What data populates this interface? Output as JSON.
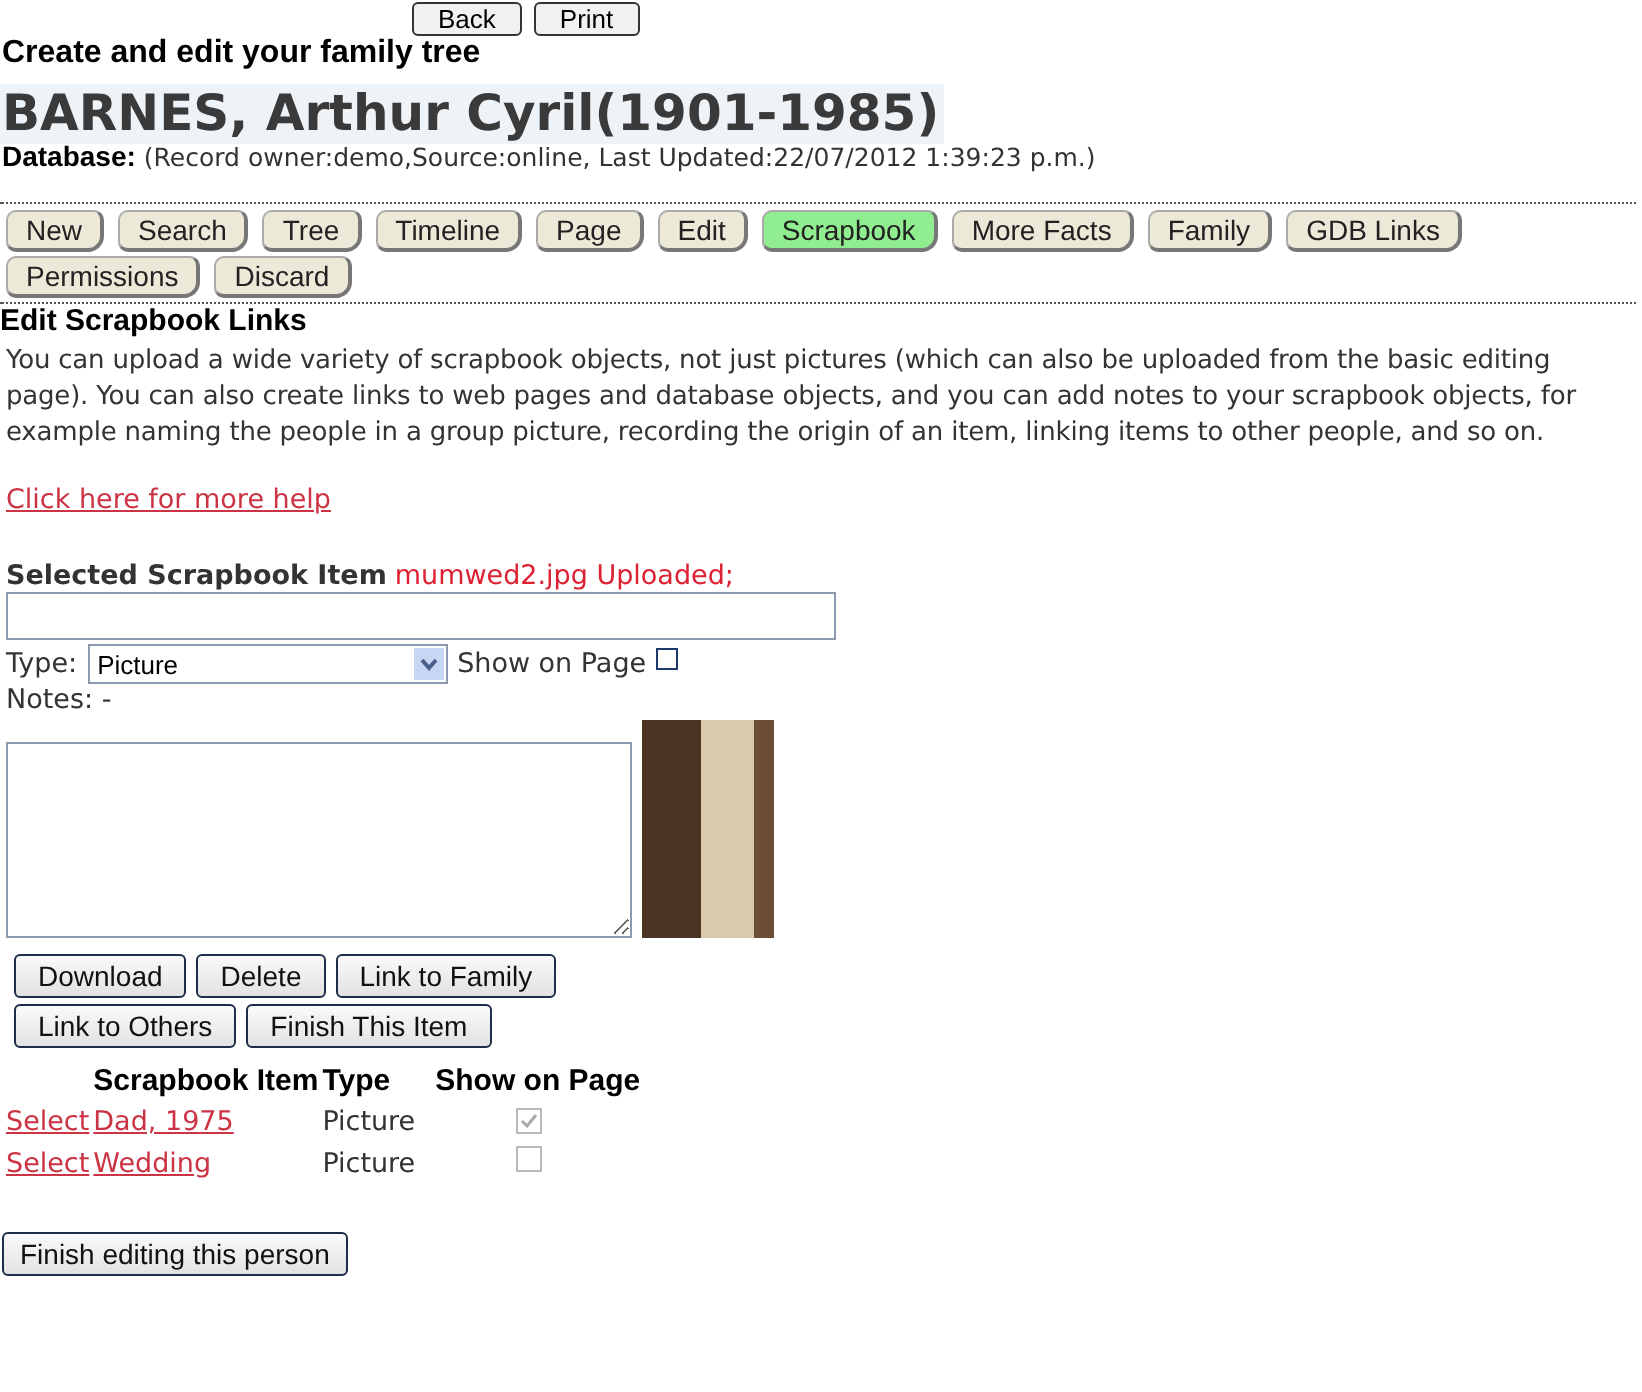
{
  "top_buttons": [
    "Back",
    "Print"
  ],
  "page_heading": "Create and edit your family tree",
  "person": {
    "name": "BARNES, Arthur Cyril(1901-1985)",
    "database_label": "Database:",
    "database_info": "(Record owner:demo,Source:online, Last Updated:22/07/2012 1:39:23 p.m.)"
  },
  "tabs": [
    {
      "label": "New",
      "selected": false
    },
    {
      "label": "Search",
      "selected": false
    },
    {
      "label": "Tree",
      "selected": false
    },
    {
      "label": "Timeline",
      "selected": false
    },
    {
      "label": "Page",
      "selected": false
    },
    {
      "label": "Edit",
      "selected": false
    },
    {
      "label": "Scrapbook",
      "selected": true
    },
    {
      "label": "More Facts",
      "selected": false
    },
    {
      "label": "Family",
      "selected": false
    },
    {
      "label": "GDB Links",
      "selected": false
    },
    {
      "label": "Permissions",
      "selected": false
    },
    {
      "label": "Discard",
      "selected": false
    }
  ],
  "section_title": "Edit Scrapbook Links",
  "intro": "You can upload a wide variety of scrapbook objects, not just pictures (which can also be uploaded from the basic editing page). You can also create links to web pages and database objects, and you can add notes to your scrapbook objects, for example naming the people in a group picture, recording the origin of an item, linking items to other people, and so on.",
  "help_link": "Click here for more help",
  "selected_item": {
    "label": "Selected Scrapbook Item",
    "status": "mumwed2.jpg Uploaded;",
    "type_label": "Type:",
    "type_value": "Picture",
    "show_label": "Show on Page",
    "show_checked": false,
    "notes_label": "Notes: -"
  },
  "action_buttons": [
    [
      "Download",
      "Delete",
      "Link to Family"
    ],
    [
      "Link to Others",
      "Finish This Item"
    ]
  ],
  "table": {
    "columns": [
      "Scrapbook Item",
      "Type",
      "Show on Page"
    ],
    "rows": [
      {
        "select": "Select",
        "item": "Dad, 1975",
        "type": "Picture",
        "checked": true
      },
      {
        "select": "Select",
        "item": "Wedding",
        "type": "Picture",
        "checked": false
      }
    ]
  },
  "finish_button": "Finish editing this person"
}
